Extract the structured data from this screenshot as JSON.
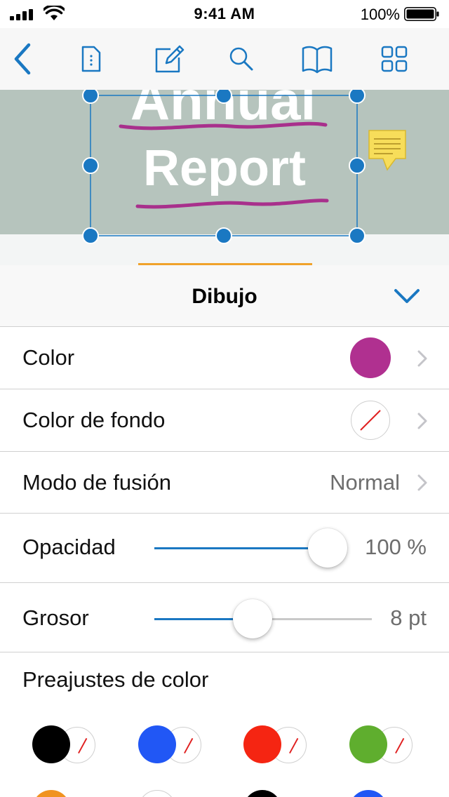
{
  "status_bar": {
    "time": "9:41 AM",
    "battery_percent": "100%"
  },
  "toolbar": {
    "icons": [
      "back-chevron-icon",
      "document-outline-icon",
      "edit-pencil-icon",
      "search-icon",
      "book-icon",
      "grid-icon"
    ],
    "accent_color": "#1a78c2"
  },
  "document": {
    "line1": "Annual",
    "line2": "Report",
    "band_color": "#b6c4bd",
    "ink_color": "#a8308c",
    "note_color": "#f7dd5a"
  },
  "panel": {
    "title": "Dibujo",
    "tab_indicator_color": "#f0a22b",
    "rows": {
      "color": {
        "label": "Color",
        "swatch_color": "#b03090"
      },
      "background_color": {
        "label": "Color de fondo",
        "swatch": "none"
      },
      "blend_mode": {
        "label": "Modo de fusión",
        "value": "Normal"
      },
      "opacity": {
        "label": "Opacidad",
        "value": "100 %",
        "level": 1.0
      },
      "thickness": {
        "label": "Grosor",
        "value": "8 pt",
        "level": 0.45
      }
    },
    "presets": {
      "label": "Preajustes de color",
      "items": [
        {
          "fill": "#000000",
          "background": "none"
        },
        {
          "fill": "#2157f5",
          "background": "none"
        },
        {
          "fill": "#f52512",
          "background": "none"
        },
        {
          "fill": "#5fae2e",
          "background": "none"
        }
      ],
      "partial_row": [
        "#f09320",
        "#ffffff",
        "#000000",
        "#2157f5"
      ]
    }
  }
}
